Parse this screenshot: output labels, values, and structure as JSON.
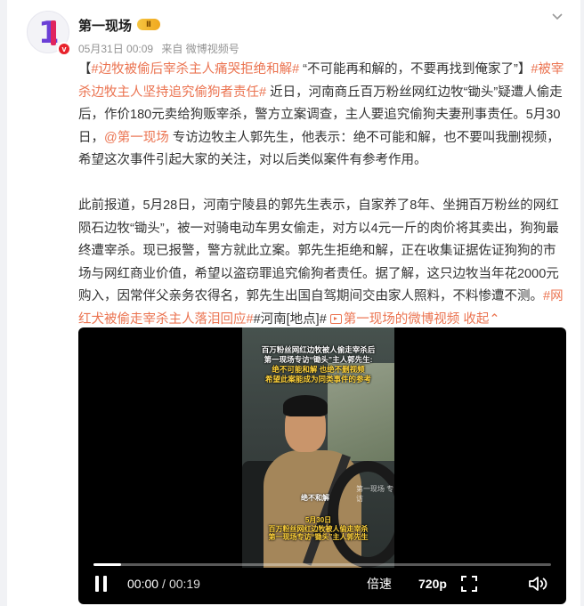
{
  "author": {
    "name": "第一现场",
    "rank_badge": "Ⅱ",
    "verified_badge": "v",
    "avatar_text": "1"
  },
  "meta": {
    "date": "05月31日 00:09",
    "source": "来自 微博视频号"
  },
  "post": {
    "p1": [
      {
        "t": "【",
        "s": "normal"
      },
      {
        "t": "#边牧被偷后宰杀主人痛哭拒绝和解#",
        "s": "orange"
      },
      {
        "t": " “不可能再和解的，不要再找到俺家了”】",
        "s": "normal"
      },
      {
        "t": "#被宰杀边牧主人坚持追究偷狗者责任#",
        "s": "orange"
      },
      {
        "t": " 近日，河南商丘百万粉丝网红边牧“锄头”疑遭人偷走后，作价180元卖给狗贩宰杀，警方立案调查，主人要追究偷狗夫妻刑事责任。5月30日，",
        "s": "normal"
      },
      {
        "t": "@第一现场",
        "s": "orange"
      },
      {
        "t": " 专访边牧主人郭先生，他表示：绝不可能和解，也不要叫我删视频，希望这次事件引起大家的关注，对以后类似案件有参考作用。",
        "s": "normal"
      }
    ],
    "p2": [
      {
        "t": "此前报道，5月28日，河南宁陵县的郭先生表示，自家养了8年、坐拥百万粉丝的网红陨石边牧“锄头”，被一对骑电动车男女偷走，对方以4元一斤的肉价将其卖出，狗狗最终遭宰杀。现已报警，警方就此立案。郭先生拒绝和解，正在收集证据佐证狗狗的市场与网红商业价值，希望以盗窃罪追究偷狗者责任。据了解，这只边牧当年花2000元购入，因常伴父亲务农得名，郭先生出国自驾期间交由家人照料，不料惨遭不测。",
        "s": "normal"
      },
      {
        "t": "#网红犬被偷走宰杀主人落泪回应#",
        "s": "orange"
      },
      {
        "t": "#河南[地点]# ",
        "s": "normal"
      },
      {
        "t": "第一现场的微博视频",
        "s": "orange",
        "icon": "video-link"
      },
      {
        "t": " 收起",
        "s": "orange"
      },
      {
        "t": "⌃",
        "s": "orange"
      }
    ]
  },
  "video": {
    "caption_lines": [
      "百万粉丝网红边牧被人偷走宰杀后",
      "第一现场专访“锄头”主人郭先生:",
      "绝不可能和解 也绝不删视频",
      "希望此案能成为同类事件的参考"
    ],
    "mid_caption": "绝不和解",
    "watermark": "第一现场 专访",
    "bottom_caption": [
      "5月30日",
      "百万粉丝网红边牧被人偷走宰杀",
      "第一现场专访“锄头”主人郭先生"
    ],
    "progress": 0.06,
    "current_time": "00:00",
    "separator": "/",
    "duration": "00:19",
    "speed_label": "倍速",
    "quality_label": "720p"
  }
}
